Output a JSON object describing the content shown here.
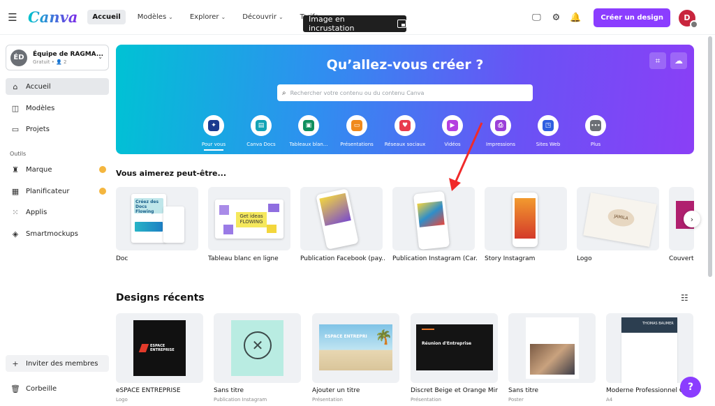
{
  "topbar": {
    "logo": "Canva",
    "nav": [
      "Accueil",
      "Modèles",
      "Explorer",
      "Découvrir",
      "Tarifs"
    ],
    "tooltip": "Image en incrustation",
    "create_button": "Créer un design",
    "avatar_initial": "D"
  },
  "sidebar": {
    "team_initials": "ÉD",
    "team_name": "Équipe de RAGMA...",
    "team_sub": "Gratuit • 👤 2",
    "items": [
      {
        "label": "Accueil",
        "icon": "home-icon"
      },
      {
        "label": "Modèles",
        "icon": "templates-icon"
      },
      {
        "label": "Projets",
        "icon": "folder-icon"
      }
    ],
    "tools_label": "Outils",
    "tools": [
      {
        "label": "Marque",
        "icon": "brand-icon"
      },
      {
        "label": "Planificateur",
        "icon": "calendar-icon"
      },
      {
        "label": "Applis",
        "icon": "apps-icon"
      },
      {
        "label": "Smartmockups",
        "icon": "mockups-icon"
      }
    ],
    "invite": "Inviter des membres",
    "trash": "Corbeille"
  },
  "hero": {
    "title": "Qu’allez-vous créer ?",
    "search_placeholder": "Rechercher votre contenu ou du contenu Canva",
    "categories": [
      {
        "label": "Pour vous",
        "color": "#1a3a8f",
        "glyph": "✦"
      },
      {
        "label": "Canva Docs",
        "color": "#13a3b5",
        "glyph": "▤"
      },
      {
        "label": "Tableaux blan...",
        "color": "#0f8f5e",
        "glyph": "▣"
      },
      {
        "label": "Présentations",
        "color": "#f08a1d",
        "glyph": "▭"
      },
      {
        "label": "Réseaux sociaux",
        "color": "#e83b4e",
        "glyph": "♥"
      },
      {
        "label": "Vidéos",
        "color": "#b43fe0",
        "glyph": "▶"
      },
      {
        "label": "Impressions",
        "color": "#9b3fd8",
        "glyph": "⎙"
      },
      {
        "label": "Sites Web",
        "color": "#2e5fe0",
        "glyph": "◳"
      },
      {
        "label": "Plus",
        "color": "#6b6f75",
        "glyph": "•••"
      }
    ]
  },
  "suggestions": {
    "title": "Vous aimerez peut-être...",
    "items": [
      {
        "label": "Doc",
        "thumb_text": "Créez des Docs Flowing"
      },
      {
        "label": "Tableau blanc en ligne",
        "thumb_text": "Get ideas FLOWING"
      },
      {
        "label": "Publication Facebook (pay..."
      },
      {
        "label": "Publication Instagram (Car..."
      },
      {
        "label": "Story Instagram"
      },
      {
        "label": "Logo",
        "thumb_text": "JAMILA"
      },
      {
        "label": "Couvertu"
      }
    ]
  },
  "recent": {
    "title": "Designs récents",
    "items": [
      {
        "label": "eSPACE ENTREPRISE",
        "type": "Logo",
        "thumb_text": "ESPACE ENTREPRISE"
      },
      {
        "label": "Sans titre",
        "type": "Publication Instagram"
      },
      {
        "label": "Ajouter un titre",
        "type": "Présentation",
        "thumb_text": "ESPACE ENTREPRI"
      },
      {
        "label": "Discret Beige et Orange Mini...",
        "type": "Présentation",
        "thumb_text": "Réunion d'Entreprise"
      },
      {
        "label": "Sans titre",
        "type": "Poster"
      },
      {
        "label": "Moderne Professionnel C...",
        "type": "A4",
        "thumb_text": "THOMAS BAUMER"
      }
    ]
  },
  "help_label": "?"
}
